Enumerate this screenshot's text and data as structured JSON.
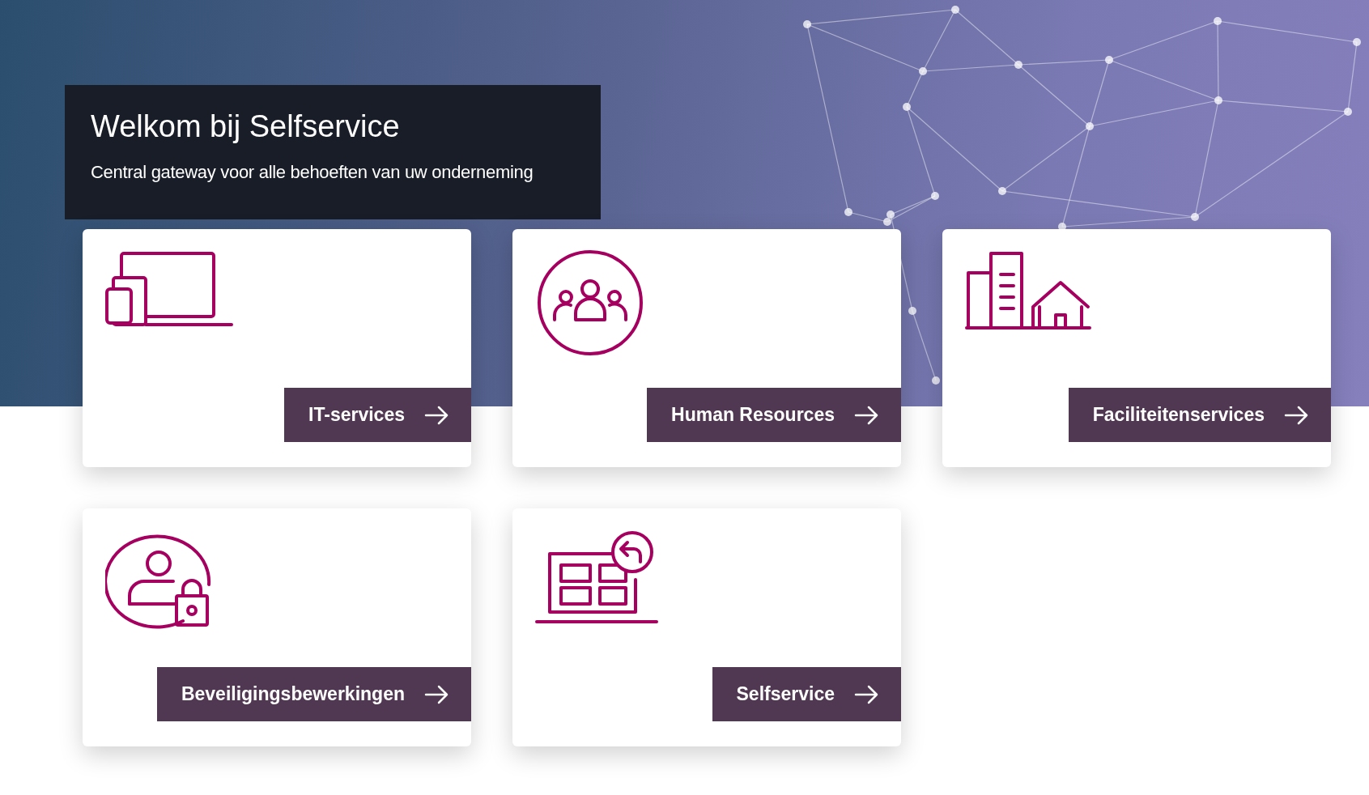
{
  "hero": {
    "title": "Welkom bij Selfservice",
    "subtitle": "Central gateway voor alle behoeften van uw onderneming"
  },
  "cards": [
    {
      "kind": "devices",
      "label": "IT-services"
    },
    {
      "kind": "people",
      "label": "Human Resources"
    },
    {
      "kind": "buildings",
      "label": "Faciliteitenservices"
    },
    {
      "kind": "security",
      "label": "Beveiligingsbewerkingen"
    },
    {
      "kind": "selfservice",
      "label": "Selfservice"
    }
  ]
}
